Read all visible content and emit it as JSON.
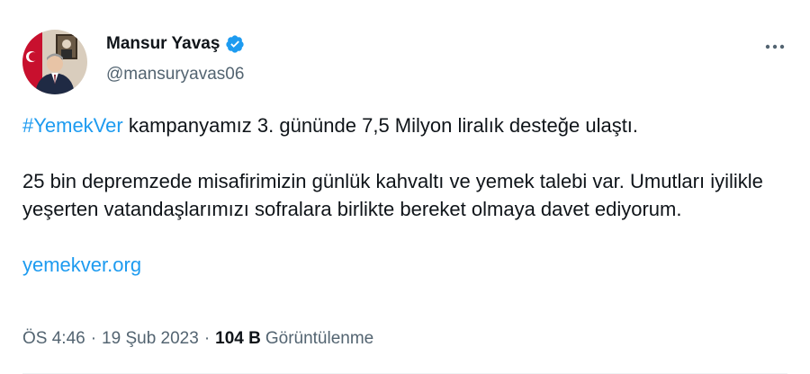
{
  "author": {
    "display_name": "Mansur Yavaş",
    "handle": "@mansuryavas06",
    "verified": true
  },
  "tweet": {
    "hashtag": "#YemekVer",
    "line1_rest": " kampanyamız 3. gününde 7,5 Milyon liralık desteğe ulaştı.",
    "paragraph2": "25 bin depremzede misafirimizin günlük kahvaltı ve yemek talebi var. Umutları iyilikle yeşerten vatandaşlarımızı sofralara birlikte bereket olmaya davet ediyorum.",
    "link": "yemekver.org"
  },
  "meta": {
    "time": "ÖS 4:46",
    "separator": "·",
    "date": "19 Şub 2023",
    "views_count": "104 B",
    "views_label": "Görüntülenme"
  },
  "colors": {
    "accent": "#1d9bf0",
    "text": "#0f1419",
    "secondary": "#536471"
  },
  "icons": {
    "verified": "verified-badge-icon",
    "more": "more-horizontal-icon"
  }
}
